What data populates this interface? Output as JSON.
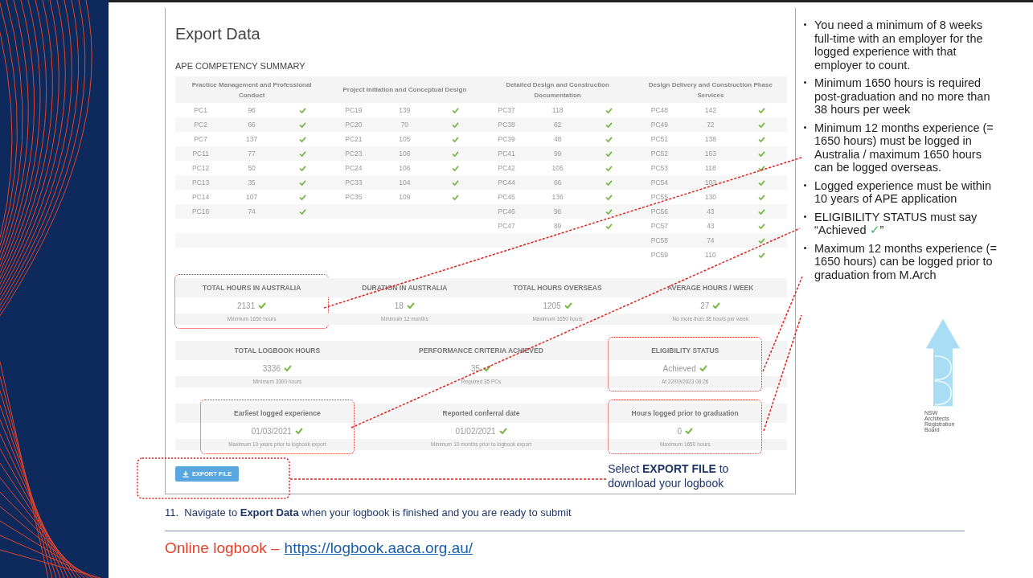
{
  "app": {
    "title": "Export Data",
    "section_heading": "APE COMPETENCY SUMMARY",
    "groups": [
      {
        "heading": "Practice Management and Professional Conduct",
        "rows": [
          {
            "pc": "PC1",
            "hours": "96",
            "met": true
          },
          {
            "pc": "PC2",
            "hours": "66",
            "met": true
          },
          {
            "pc": "PC7",
            "hours": "137",
            "met": true
          },
          {
            "pc": "PC11",
            "hours": "77",
            "met": true
          },
          {
            "pc": "PC12",
            "hours": "50",
            "met": true
          },
          {
            "pc": "PC13",
            "hours": "35",
            "met": true
          },
          {
            "pc": "PC14",
            "hours": "107",
            "met": true
          },
          {
            "pc": "PC16",
            "hours": "74",
            "met": true
          }
        ]
      },
      {
        "heading": "Project Initiation and Conceptual Design",
        "rows": [
          {
            "pc": "PC19",
            "hours": "139",
            "met": true
          },
          {
            "pc": "PC20",
            "hours": "70",
            "met": true
          },
          {
            "pc": "PC21",
            "hours": "105",
            "met": true
          },
          {
            "pc": "PC23",
            "hours": "106",
            "met": true
          },
          {
            "pc": "PC24",
            "hours": "106",
            "met": true
          },
          {
            "pc": "PC33",
            "hours": "104",
            "met": true
          },
          {
            "pc": "PC35",
            "hours": "109",
            "met": true
          }
        ]
      },
      {
        "heading": "Detailed Design and Construction Documentation",
        "rows": [
          {
            "pc": "PC37",
            "hours": "118",
            "met": true
          },
          {
            "pc": "PC38",
            "hours": "62",
            "met": true
          },
          {
            "pc": "PC39",
            "hours": "48",
            "met": true
          },
          {
            "pc": "PC41",
            "hours": "99",
            "met": true
          },
          {
            "pc": "PC42",
            "hours": "105",
            "met": true
          },
          {
            "pc": "PC44",
            "hours": "66",
            "met": true
          },
          {
            "pc": "PC45",
            "hours": "136",
            "met": true
          },
          {
            "pc": "PC46",
            "hours": "96",
            "met": true
          },
          {
            "pc": "PC47",
            "hours": "89",
            "met": true
          }
        ]
      },
      {
        "heading": "Design Delivery and Construction Phase Services",
        "rows": [
          {
            "pc": "PC48",
            "hours": "142",
            "met": true
          },
          {
            "pc": "PC49",
            "hours": "72",
            "met": true
          },
          {
            "pc": "PC51",
            "hours": "138",
            "met": true
          },
          {
            "pc": "PC52",
            "hours": "163",
            "met": true
          },
          {
            "pc": "PC53",
            "hours": "118",
            "met": true
          },
          {
            "pc": "PC54",
            "hours": "103",
            "met": true
          },
          {
            "pc": "PC55",
            "hours": "130",
            "met": true
          },
          {
            "pc": "PC56",
            "hours": "43",
            "met": true
          },
          {
            "pc": "PC57",
            "hours": "43",
            "met": true
          },
          {
            "pc": "PC58",
            "hours": "74",
            "met": true
          },
          {
            "pc": "PC59",
            "hours": "110",
            "met": true
          }
        ]
      }
    ],
    "summary_rows": [
      [
        {
          "label": "TOTAL HOURS IN AUSTRALIA",
          "value": "2131",
          "met": true,
          "note": "Minimum 1650 hours",
          "highlighted": true
        },
        {
          "label": "DURATION IN AUSTRALIA",
          "value": "18",
          "met": true,
          "note": "Minimum 12 months",
          "highlighted": false
        },
        {
          "label": "TOTAL HOURS OVERSEAS",
          "value": "1205",
          "met": true,
          "note": "Maximum 1650 hours",
          "highlighted": false
        },
        {
          "label": "AVERAGE HOURS / WEEK",
          "value": "27",
          "met": true,
          "note": "No more than 38 hours per week",
          "highlighted": false
        }
      ],
      [
        {
          "label": "TOTAL LOGBOOK HOURS",
          "value": "3336",
          "met": true,
          "note": "Minimum 3300 hours",
          "highlighted": false
        },
        {
          "label": "PERFORMANCE CRITERIA ACHIEVED",
          "value": "35",
          "met": true,
          "note": "Required 35 PCs",
          "highlighted": false
        },
        {
          "label": "ELIGIBILITY STATUS",
          "value": "Achieved",
          "met": true,
          "note": "At 22/09/2023 08:26",
          "highlighted": true
        }
      ],
      [
        {
          "label": "Earliest logged experience",
          "value": "01/03/2021",
          "met": true,
          "note": "Maximum 10 years prior to logbook export",
          "highlighted": true
        },
        {
          "label": "Reported conferral date",
          "value": "01/02/2021",
          "met": true,
          "note": "Minimum 10 months prior to logbook export",
          "highlighted": false
        },
        {
          "label": "Hours logged prior to graduation",
          "value": "0",
          "met": true,
          "note": "Maximum 1650 hours",
          "highlighted": true
        }
      ]
    ],
    "export_button": {
      "label": "EXPORT FILE",
      "highlighted": true
    }
  },
  "callout": "Select **EXPORT FILE** to download your logbook",
  "notes": [
    {
      "parts": [
        {
          "kind": "plain",
          "text": "You need a minimum of 8 weeks full-time with an employer for the logged experience with that employer to count."
        }
      ]
    },
    {
      "parts": [
        {
          "kind": "plain",
          "text": "Minimum 1650 hours is required post-graduation and no more than 38 hours per week"
        }
      ]
    },
    {
      "parts": [
        {
          "kind": "plain",
          "text": "Minimum 12 months experience (= 1650 hours) must be logged in Australia / maximum 1650 hours can be logged overseas."
        }
      ]
    },
    {
      "parts": [
        {
          "kind": "plain",
          "text": "Logged experience must be within 10 years of APE application"
        }
      ]
    },
    {
      "parts": [
        {
          "kind": "plain",
          "text": "ELIGIBILITY STATUS must say “Achieved "
        },
        {
          "kind": "check",
          "text": "✓"
        },
        {
          "kind": "plain",
          "text": "”"
        }
      ]
    },
    {
      "parts": [
        {
          "kind": "plain",
          "text": "Maximum 12 months experience (= 1650 hours) can be logged prior to graduation from M.Arch"
        }
      ]
    }
  ],
  "logo": {
    "lines": [
      "NSW",
      "Architects",
      "Registration",
      "Board"
    ]
  },
  "step": {
    "number": "11.",
    "text": "Navigate to **Export Data** when your logbook is finished and you are ready to submit"
  },
  "footer": {
    "label": "Online logbook –",
    "link": "https://logbook.aaca.org.au/"
  }
}
